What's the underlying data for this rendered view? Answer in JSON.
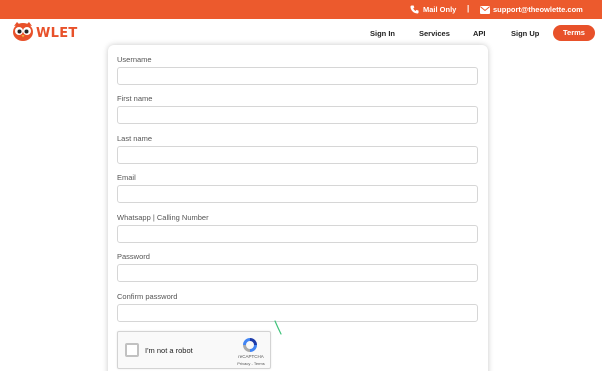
{
  "topbar": {
    "mail_only": "Mail Only",
    "separator": "|",
    "email": "support@theowlette.com"
  },
  "brand": {
    "name": "WLET",
    "color": "#e8512a"
  },
  "nav": {
    "items": [
      "Sign In",
      "Services",
      "API",
      "Sign Up"
    ],
    "terms": "Terms"
  },
  "form": {
    "fields": [
      {
        "label": "Username",
        "value": ""
      },
      {
        "label": "First name",
        "value": ""
      },
      {
        "label": "Last name",
        "value": ""
      },
      {
        "label": "Email",
        "value": ""
      },
      {
        "label": "Whatsapp | Calling Number",
        "value": ""
      },
      {
        "label": "Password",
        "value": ""
      },
      {
        "label": "Confirm password",
        "value": ""
      }
    ]
  },
  "captcha": {
    "label": "I'm not a robot",
    "brand": "reCAPTCHA",
    "links": "Privacy - Terms"
  },
  "colors": {
    "accent": "#ec5a2d"
  }
}
